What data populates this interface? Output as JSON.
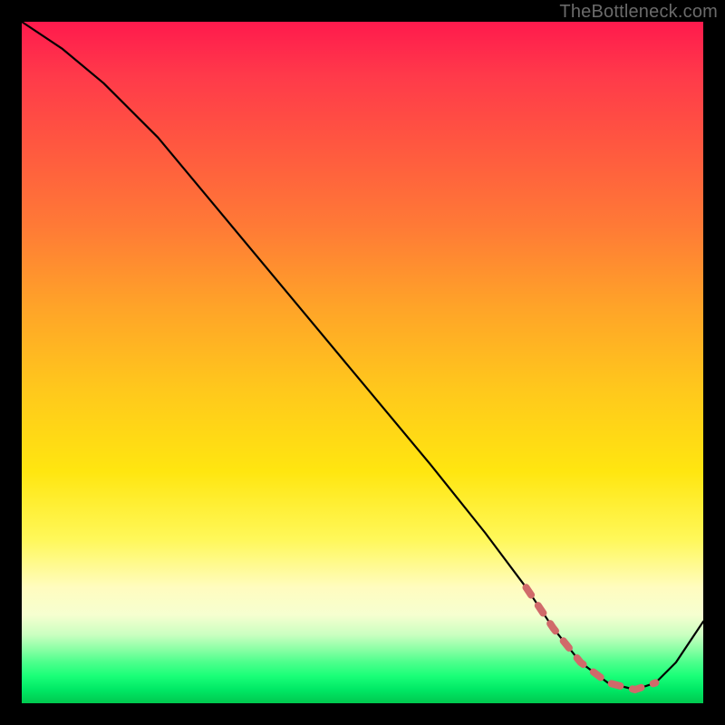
{
  "watermark": "TheBottleneck.com",
  "chart_data": {
    "type": "line",
    "title": "",
    "xlabel": "",
    "ylabel": "",
    "xlim": [
      0,
      100
    ],
    "ylim": [
      0,
      100
    ],
    "grid": false,
    "legend": false,
    "series": [
      {
        "name": "curve",
        "x": [
          0,
          6,
          12,
          20,
          30,
          40,
          50,
          60,
          68,
          74,
          78,
          82,
          86,
          90,
          93,
          96,
          100
        ],
        "y": [
          100,
          96,
          91,
          83,
          71,
          59,
          47,
          35,
          25,
          17,
          11,
          6,
          3,
          2,
          3,
          6,
          12
        ]
      },
      {
        "name": "optimal-range-marker",
        "x": [
          74,
          78,
          82,
          86,
          90,
          93
        ],
        "y": [
          17,
          11,
          6,
          3,
          2,
          3
        ]
      }
    ],
    "annotations": [],
    "colors": {
      "gradient_top": "#ff1a4d",
      "gradient_mid": "#ffe610",
      "gradient_bottom": "#00c94f",
      "curve": "#000000",
      "marker": "#d06a6a"
    }
  }
}
